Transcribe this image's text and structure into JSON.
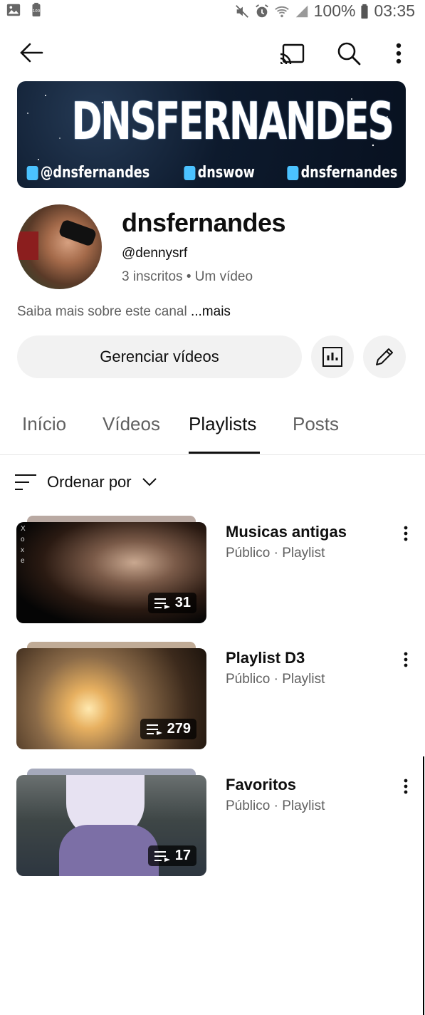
{
  "status_bar": {
    "battery_text": "100%",
    "time": "03:35",
    "icons": [
      "gallery-icon",
      "battery-saver-icon",
      "mute-icon",
      "alarm-icon",
      "wifi-icon",
      "signal-icon",
      "battery-icon"
    ]
  },
  "top_bar": {
    "icons": [
      "back-arrow-icon",
      "cast-icon",
      "search-icon",
      "more-vertical-icon"
    ]
  },
  "banner": {
    "title": "DNSFERNANDES",
    "socials": [
      "@dnsfernandes",
      "dnswow",
      "dnsfernandes"
    ]
  },
  "channel": {
    "name": "dnsfernandes",
    "handle": "@dennysrf",
    "subscribers": "3 inscritos",
    "separator": "•",
    "videos": "Um vídeo",
    "about_text": "Saiba mais sobre este canal",
    "about_more": "...mais",
    "manage_button": "Gerenciar vídeos"
  },
  "tabs": [
    {
      "label": "Início"
    },
    {
      "label": "Vídeos"
    },
    {
      "label": "Playlists",
      "active": true
    },
    {
      "label": "Posts"
    }
  ],
  "sort": {
    "label": "Ordenar por"
  },
  "playlists": [
    {
      "title": "Musicas antigas",
      "subtitle": "Público · Playlist",
      "count": "31",
      "thumb_text": "Xoxe"
    },
    {
      "title": "Playlist D3",
      "subtitle": "Público · Playlist",
      "count": "279"
    },
    {
      "title": "Favoritos",
      "subtitle": "Público · Playlist",
      "count": "17"
    }
  ],
  "colors": {
    "background": "#ffffff",
    "text_primary": "#0f0f0f",
    "text_secondary": "#606060",
    "button_bg": "#f2f2f2"
  }
}
